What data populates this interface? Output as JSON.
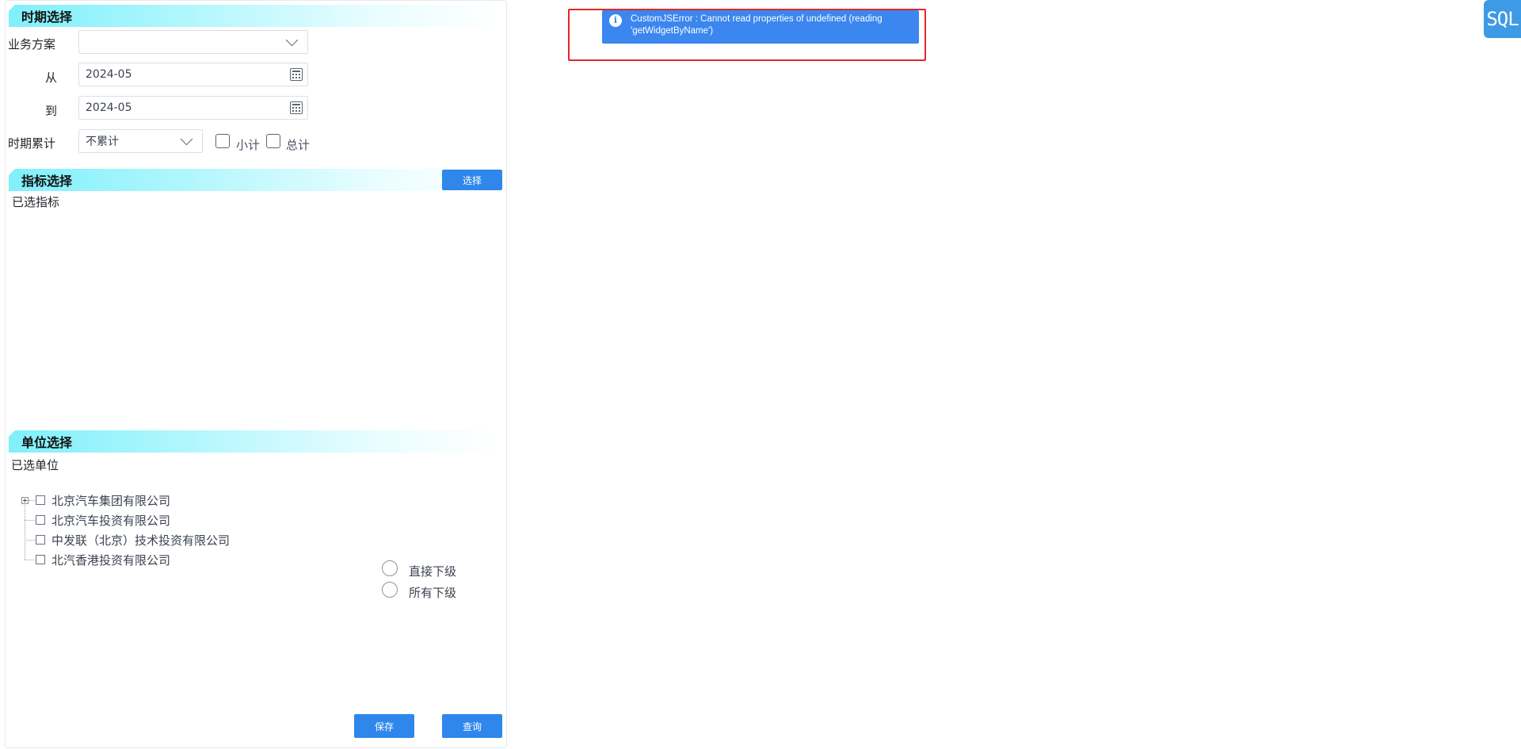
{
  "period_section": {
    "title": "时期选择",
    "business_plan_label": "业务方案",
    "business_plan_value": "",
    "from_label": "从",
    "from_value": "2024-05",
    "to_label": "到",
    "to_value": "2024-05",
    "accumulate_label": "时期累计",
    "accumulate_value": "不累计",
    "subtotal_label": "小计",
    "total_label": "总计"
  },
  "indicator_section": {
    "title": "指标选择",
    "select_button": "选择",
    "selected_label": "已选指标"
  },
  "unit_section": {
    "title": "单位选择",
    "selected_label": "已选单位",
    "tree_items": [
      "北京汽车集团有限公司",
      "北京汽车投资有限公司",
      "中发联（北京）技术投资有限公司",
      "北汽香港投资有限公司"
    ],
    "radio_direct": "直接下级",
    "radio_all": "所有下级"
  },
  "actions": {
    "save": "保存",
    "query": "查询"
  },
  "toast": {
    "message": "CustomJSError : Cannot read properties of undefined (reading 'getWidgetByName')",
    "icon": "info-icon"
  },
  "sql_badge": "SQL",
  "colors": {
    "primary": "#2f87ec",
    "toast": "#3b86ef",
    "highlight": "#e3262a",
    "header_gradient": "#7ff0fb",
    "sql_badge": "#3d9be6"
  }
}
